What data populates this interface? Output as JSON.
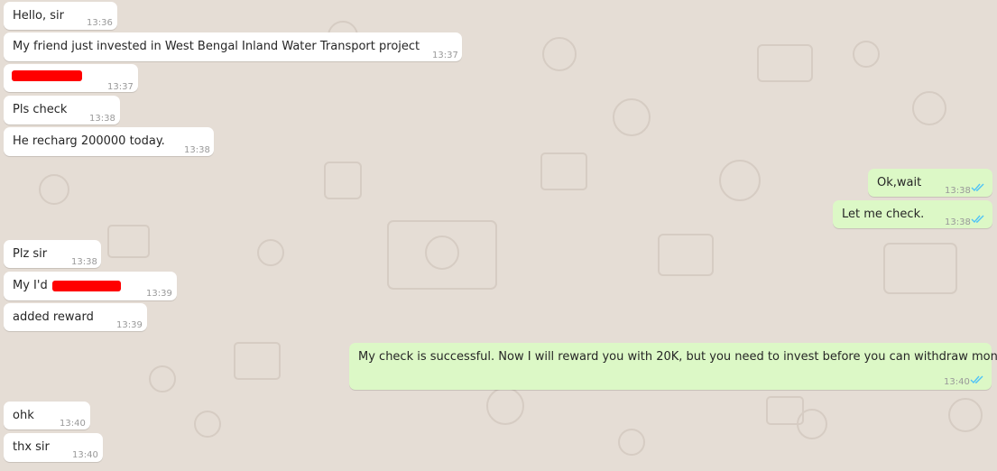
{
  "colors": {
    "wallpaper": "#e5ddd5",
    "incoming_bubble": "#ffffff",
    "outgoing_bubble": "#dcf8c6",
    "read_ticks": "#4fc3f7",
    "redaction": "#ff0000",
    "timestamp": "#999999"
  },
  "messages": [
    {
      "direction": "incoming",
      "text": "Hello, sir",
      "time": "13:36"
    },
    {
      "direction": "incoming",
      "text": "My friend just invested in West Bengal Inland Water Transport project",
      "time": "13:37"
    },
    {
      "direction": "incoming",
      "text": "",
      "time": "13:37",
      "redacted": true
    },
    {
      "direction": "incoming",
      "text": "Pls check",
      "time": "13:38"
    },
    {
      "direction": "incoming",
      "text": "He recharg 200000 today.",
      "time": "13:38"
    },
    {
      "direction": "outgoing",
      "text": "Ok,wait",
      "time": "13:38",
      "status": "read"
    },
    {
      "direction": "outgoing",
      "text": "Let me check.",
      "time": "13:38",
      "status": "read"
    },
    {
      "direction": "incoming",
      "text": "Plz sir",
      "time": "13:38"
    },
    {
      "direction": "incoming",
      "text": "My I'd",
      "time": "13:39",
      "redacted": true
    },
    {
      "direction": "incoming",
      "text": "added reward",
      "time": "13:39"
    },
    {
      "direction": "outgoing",
      "text": "My check is successful. Now I will reward you with 20K, but you need to invest before you can withdraw money",
      "time": "13:40",
      "status": "read"
    },
    {
      "direction": "incoming",
      "text": "ohk",
      "time": "13:40"
    },
    {
      "direction": "incoming",
      "text": "thx sir",
      "time": "13:40"
    }
  ]
}
